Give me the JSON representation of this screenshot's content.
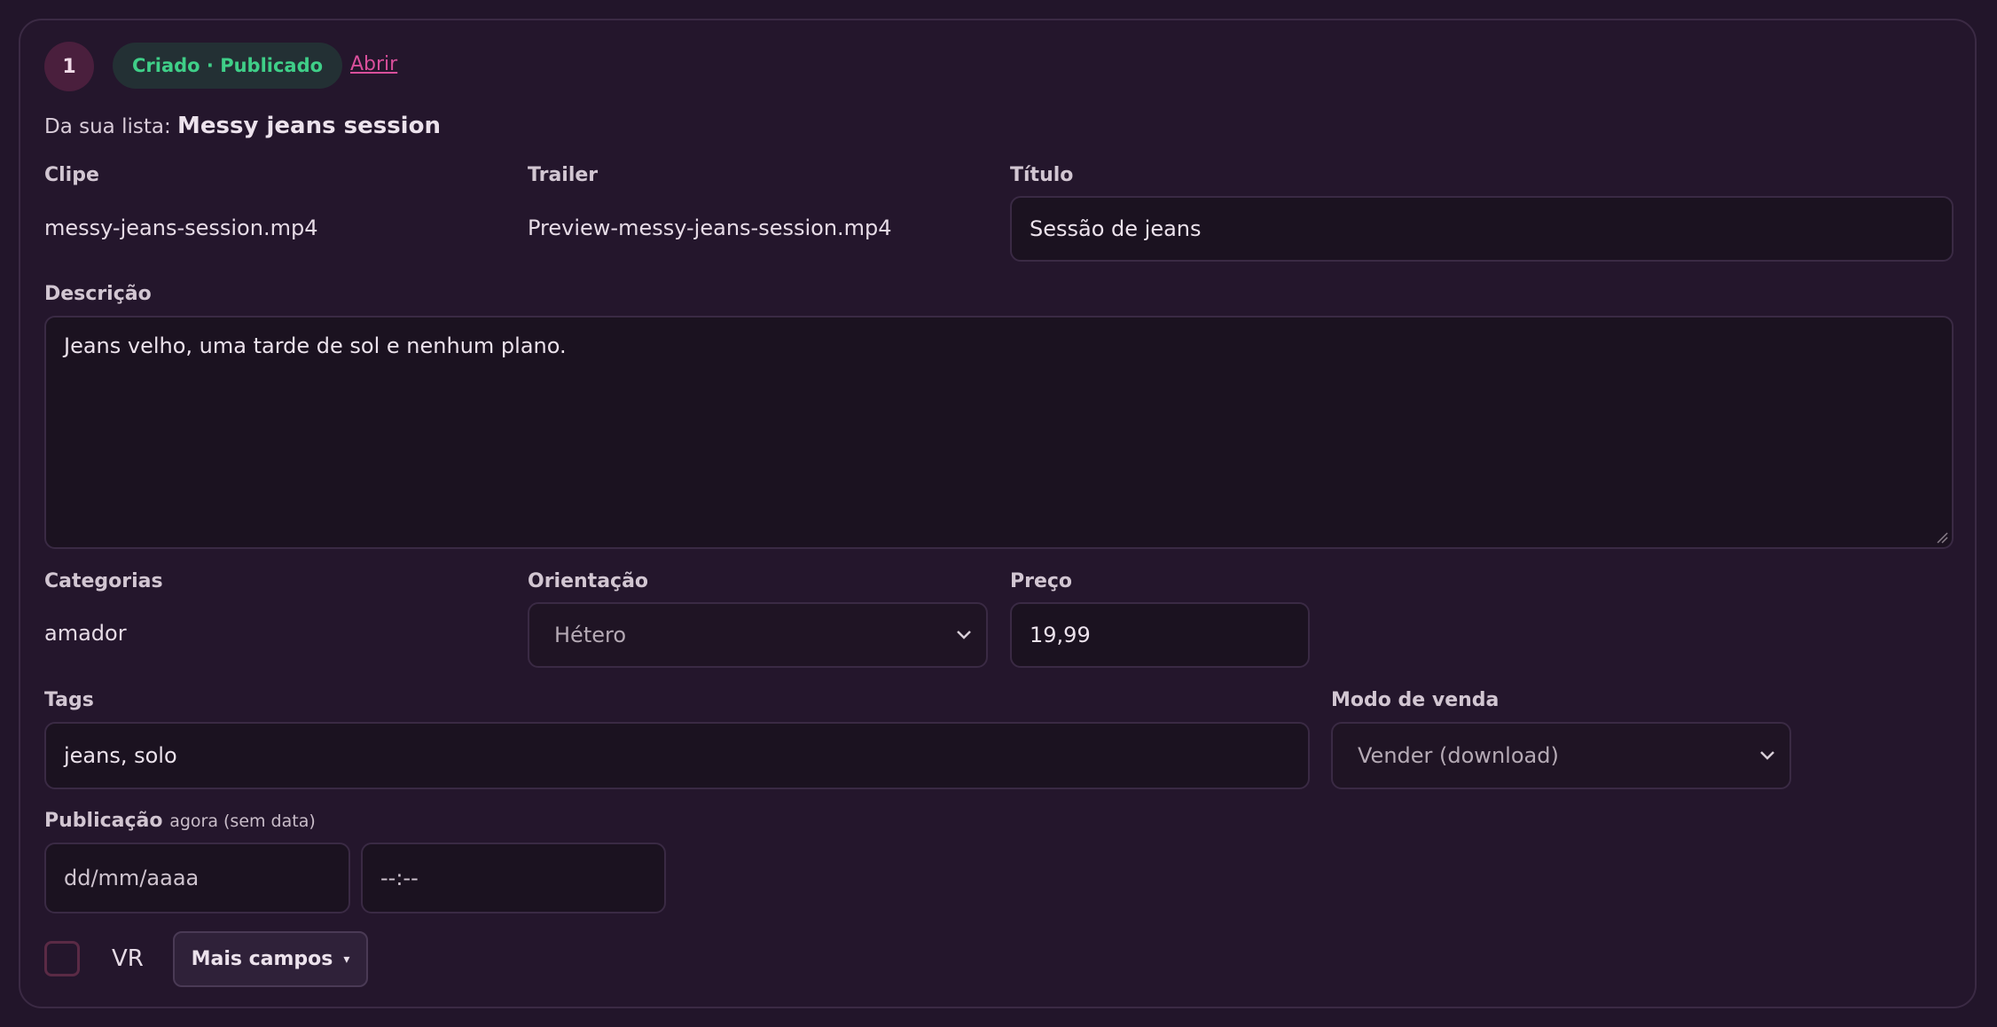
{
  "item": {
    "number": "1",
    "status": "Criado · Publicado",
    "open_link": "Abrir",
    "list_prefix": "Da sua lista:",
    "list_name": "Messy jeans session"
  },
  "clip": {
    "label": "Clipe",
    "value": "messy-jeans-session.mp4"
  },
  "trailer": {
    "label": "Trailer",
    "value": "Preview-messy-jeans-session.mp4"
  },
  "title": {
    "label": "Título",
    "value": "Sessão de jeans"
  },
  "description": {
    "label": "Descrição",
    "value": "Jeans velho, uma tarde de sol e nenhum plano."
  },
  "categories": {
    "label": "Categorias",
    "value": "amador"
  },
  "orientation": {
    "label": "Orientação",
    "selected": "Hétero"
  },
  "price": {
    "label": "Preço",
    "value": "19,99"
  },
  "tags": {
    "label": "Tags",
    "value": "jeans, solo"
  },
  "sale_mode": {
    "label": "Modo de venda",
    "selected": "Vender (download)"
  },
  "publication": {
    "label": "Publicação",
    "hint": "agora (sem data)",
    "date_placeholder": "dd/mm/aaaa",
    "time_placeholder": "--:--"
  },
  "vr": {
    "label": "VR",
    "checked": false
  },
  "more_fields": {
    "label": "Mais campos",
    "caret": "▾"
  },
  "colors": {
    "background": "#22152a",
    "status_text": "#3fcf88",
    "link": "#d94f9b",
    "badge": "#4a1f3d"
  }
}
